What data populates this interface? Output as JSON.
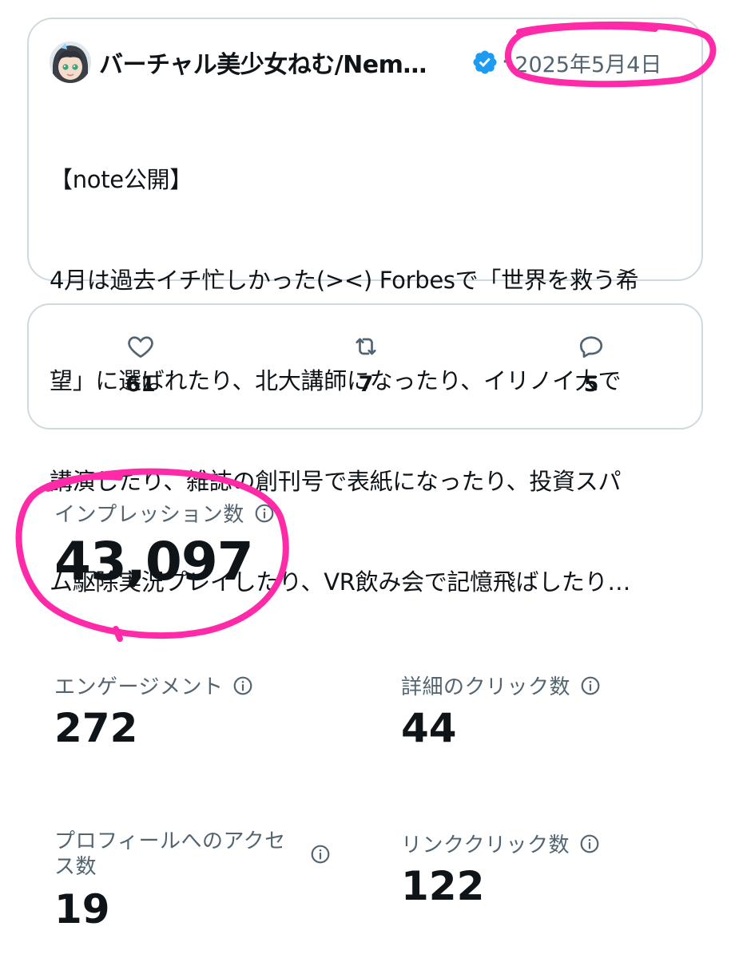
{
  "tweet": {
    "author_name": "バーチャル美少女ねむ/Nem…",
    "date": "2025年5月4日",
    "text_lines": [
      "【note公開】",
      "4月は過去イチ忙しかった(><) Forbesで「世界を救う希",
      "望」に選ばれたり、北大講師になったり、イリノイ大で",
      "講演したり、雑誌の創刊号で表紙になったり、投資スパ",
      "ム駆除実況プレイしたり、VR飲み会で記憶飛ばしたり…"
    ]
  },
  "engagement": {
    "likes": "61",
    "retweets": "7",
    "replies": "5"
  },
  "metrics": {
    "impressions": {
      "label": "インプレッション数",
      "value": "43,097"
    },
    "engagements": {
      "label": "エンゲージメント",
      "value": "272"
    },
    "detail_clicks": {
      "label": "詳細のクリック数",
      "value": "44"
    },
    "profile_visits": {
      "label_line1": "プロフィールへのアクセ",
      "label_line2": "ス数",
      "value": "19"
    },
    "link_clicks": {
      "label": "リンククリック数",
      "value": "122"
    }
  },
  "colors": {
    "text": "#0f1419",
    "secondary": "#536471",
    "border": "#cfd9de",
    "verified": "#1d9bf0",
    "annotation": "#ff2aa8"
  }
}
